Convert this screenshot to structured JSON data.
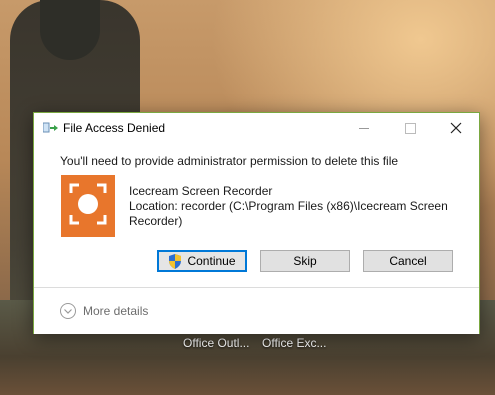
{
  "desktop": {
    "labels": [
      "Office Outl...",
      "Office Exc..."
    ]
  },
  "dialog": {
    "title": "File Access Denied",
    "heading": "You'll need to provide administrator permission to delete this file",
    "file_name": "Icecream Screen Recorder",
    "file_location": "Location: recorder (C:\\Program Files (x86)\\Icecream Screen Recorder)",
    "buttons": {
      "continue": "Continue",
      "skip": "Skip",
      "cancel": "Cancel"
    },
    "more_details": "More details"
  },
  "colors": {
    "accent": "#0078d7",
    "app_icon": "#e8762c",
    "dialog_border": "#7aa840"
  },
  "icons": [
    "file-move-icon",
    "minimize-icon",
    "maximize-icon",
    "close-icon",
    "screen-recorder-icon",
    "uac-shield-icon",
    "chevron-down-icon"
  ]
}
